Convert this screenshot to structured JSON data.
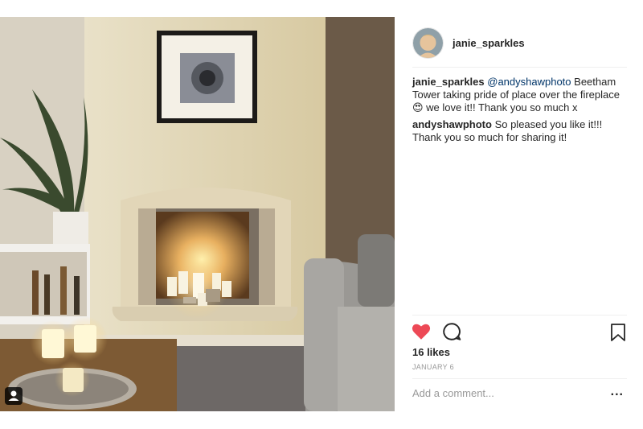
{
  "post": {
    "username": "janie_sparkles",
    "comments": [
      {
        "user": "janie_sparkles",
        "mention": "@andyshawphoto",
        "text": " Beetham Tower taking pride of place over the fireplace 😍 we love it!! Thank you so much x"
      },
      {
        "user": "andyshawphoto",
        "mention": "",
        "text": " So pleased you like it!!! Thank you so much for sharing it!"
      }
    ],
    "likes": "16 likes",
    "date": "JANUARY 6",
    "add_comment_placeholder": "Add a comment...",
    "more_label": "..."
  },
  "colors": {
    "like_red": "#ed4956",
    "text": "#262626",
    "muted": "#999999",
    "mention": "#003569"
  },
  "icons": [
    "usertag-icon",
    "heart-icon",
    "comment-icon",
    "bookmark-icon",
    "more-options-icon"
  ]
}
